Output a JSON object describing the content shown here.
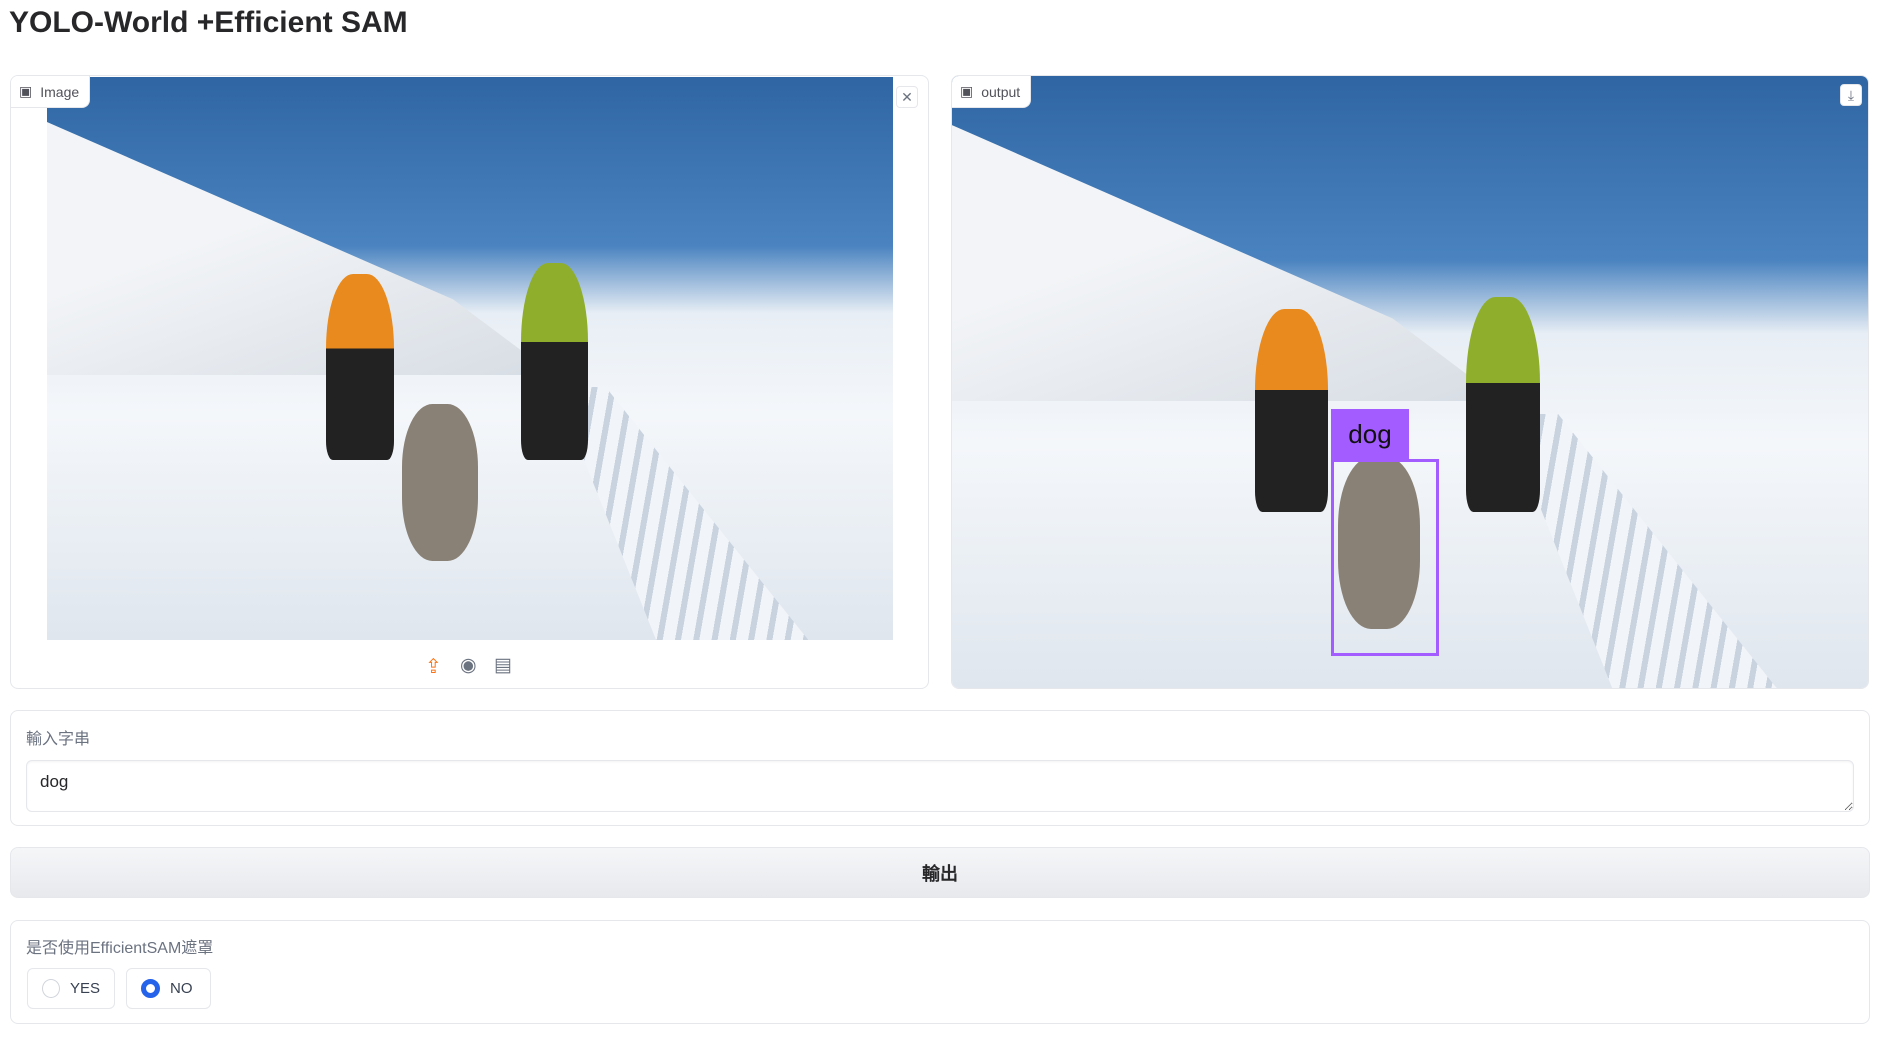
{
  "title": "YOLO-World +Efficient SAM",
  "input_image": {
    "label": "Image",
    "icon": "image-icon",
    "clear_icon": "close-icon",
    "sources": [
      "upload-icon",
      "webcam-icon",
      "clipboard-icon"
    ]
  },
  "output_image": {
    "label": "output",
    "icon": "image-icon",
    "download_icon": "download-icon",
    "detections": [
      {
        "label": "dog",
        "color": "#a35cff"
      }
    ]
  },
  "text_input": {
    "label": "輸入字串",
    "value": "dog"
  },
  "submit": {
    "label": "輸出"
  },
  "mask_option": {
    "label": "是否使用EfficientSAM遮罩",
    "options": [
      {
        "label": "YES",
        "selected": false
      },
      {
        "label": "NO",
        "selected": true
      }
    ]
  },
  "colors": {
    "accent": "#f97316",
    "radio": "#2563eb",
    "box": "#a35cff"
  }
}
